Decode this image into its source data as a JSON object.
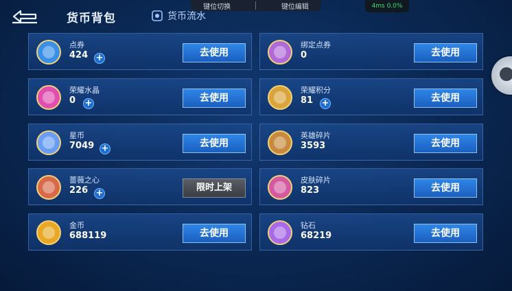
{
  "header": {
    "title": "货币背包",
    "flow_tab": "货币流水"
  },
  "overlay": {
    "left_label": "键位切换",
    "right_label": "键位编辑",
    "perf": "4ms  0.0%"
  },
  "cards": [
    {
      "name": "点券",
      "amount": "424",
      "button": "去使用",
      "has_plus": true,
      "icon": "coupon-card-icon",
      "color": "#3a8fe6"
    },
    {
      "name": "绑定点券",
      "amount": "0",
      "button": "去使用",
      "has_plus": false,
      "icon": "bound-coupon-icon",
      "color": "#b06ad8"
    },
    {
      "name": "荣耀水晶",
      "amount": "0",
      "button": "去使用",
      "has_plus": true,
      "icon": "glory-crystal-icon",
      "color": "#e04fb0"
    },
    {
      "name": "荣耀积分",
      "amount": "81",
      "button": "去使用",
      "has_plus": true,
      "icon": "glory-points-icon",
      "color": "#d9a43a"
    },
    {
      "name": "星币",
      "amount": "7049",
      "button": "去使用",
      "has_plus": true,
      "icon": "star-coin-icon",
      "color": "#6a9ef5"
    },
    {
      "name": "英雄碎片",
      "amount": "3593",
      "button": "去使用",
      "has_plus": false,
      "icon": "hero-shard-icon",
      "color": "#c88a3c"
    },
    {
      "name": "蔷薇之心",
      "amount": "226",
      "button": "限时上架",
      "has_plus": true,
      "icon": "rose-heart-icon",
      "color": "#d86a4a"
    },
    {
      "name": "皮肤碎片",
      "amount": "823",
      "button": "去使用",
      "has_plus": false,
      "icon": "skin-shard-icon",
      "color": "#d45aa0"
    },
    {
      "name": "金币",
      "amount": "688119",
      "button": "去使用",
      "has_plus": false,
      "icon": "gold-coin-icon",
      "color": "#e8a826"
    },
    {
      "name": "钻石",
      "amount": "68219",
      "button": "去使用",
      "has_plus": false,
      "icon": "diamond-icon",
      "color": "#a86ae8"
    }
  ]
}
